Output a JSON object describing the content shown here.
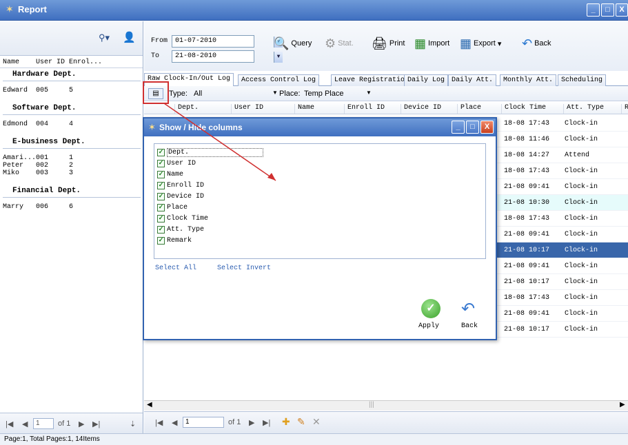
{
  "window": {
    "title": "Report"
  },
  "left": {
    "headers": [
      "Name",
      "User ID",
      "Enrol..."
    ],
    "groups": [
      {
        "dept": "Hardware Dept.",
        "rows": [
          [
            "Edward",
            "005",
            "5"
          ]
        ]
      },
      {
        "dept": "Software Dept.",
        "rows": [
          [
            "Edmond",
            "004",
            "4"
          ]
        ]
      },
      {
        "dept": "E-business Dept.",
        "rows": [
          [
            "Amari...",
            "001",
            "1"
          ],
          [
            "Peter",
            "002",
            "2"
          ],
          [
            "Miko",
            "003",
            "3"
          ]
        ]
      },
      {
        "dept": "Financial Dept.",
        "rows": [
          [
            "Marry",
            "006",
            "6"
          ]
        ]
      }
    ],
    "pager": {
      "page": "1",
      "of": "of 1"
    }
  },
  "toolbar": {
    "from_label": "From",
    "from_value": "01-07-2010",
    "to_label": "To",
    "to_value": "21-08-2010",
    "query": "Query",
    "stat": "Stat.",
    "print": "Print",
    "import": "Import",
    "export": "Export",
    "back": "Back"
  },
  "tabs": [
    "Raw Clock-In/Out Log",
    "Access Control Log",
    "Leave Registration",
    "Daily Log",
    "Daily Att.",
    "Monthly Att.",
    "Scheduling"
  ],
  "filter": {
    "type_label": "Type:",
    "type_value": "All",
    "place_label": "Place:",
    "place_value": "Temp Place"
  },
  "grid": {
    "headers": [
      "Dept.",
      "User ID",
      "Name",
      "Enroll ID",
      "Device ID",
      "Place",
      "Clock Time",
      "Att. Type",
      "R"
    ],
    "rows": [
      [
        "18-08 17:43",
        "Clock-in"
      ],
      [
        "18-08 11:46",
        "Clock-in"
      ],
      [
        "18-08 14:27",
        "Attend"
      ],
      [
        "18-08 17:43",
        "Clock-in"
      ],
      [
        "21-08 09:41",
        "Clock-in"
      ],
      [
        "21-08 10:30",
        "Clock-in"
      ],
      [
        "18-08 17:43",
        "Clock-in"
      ],
      [
        "21-08 09:41",
        "Clock-in"
      ],
      [
        "21-08 10:17",
        "Clock-in"
      ],
      [
        "21-08 09:41",
        "Clock-in"
      ],
      [
        "21-08 10:17",
        "Clock-in"
      ],
      [
        "18-08 17:43",
        "Clock-in"
      ],
      [
        "21-08 09:41",
        "Clock-in"
      ],
      [
        "21-08 10:17",
        "Clock-in"
      ]
    ],
    "pager": {
      "page": "1",
      "of": "of 1"
    }
  },
  "dialog": {
    "title": "Show / Hide columns",
    "columns": [
      "Dept.",
      "User ID",
      "Name",
      "Enroll ID",
      "Device ID",
      "Place",
      "Clock Time",
      "Att. Type",
      "Remark"
    ],
    "select_all": "Select All",
    "select_invert": "Select Invert",
    "apply": "Apply",
    "back": "Back"
  },
  "status": "Page:1, Total Pages:1, 14Items"
}
